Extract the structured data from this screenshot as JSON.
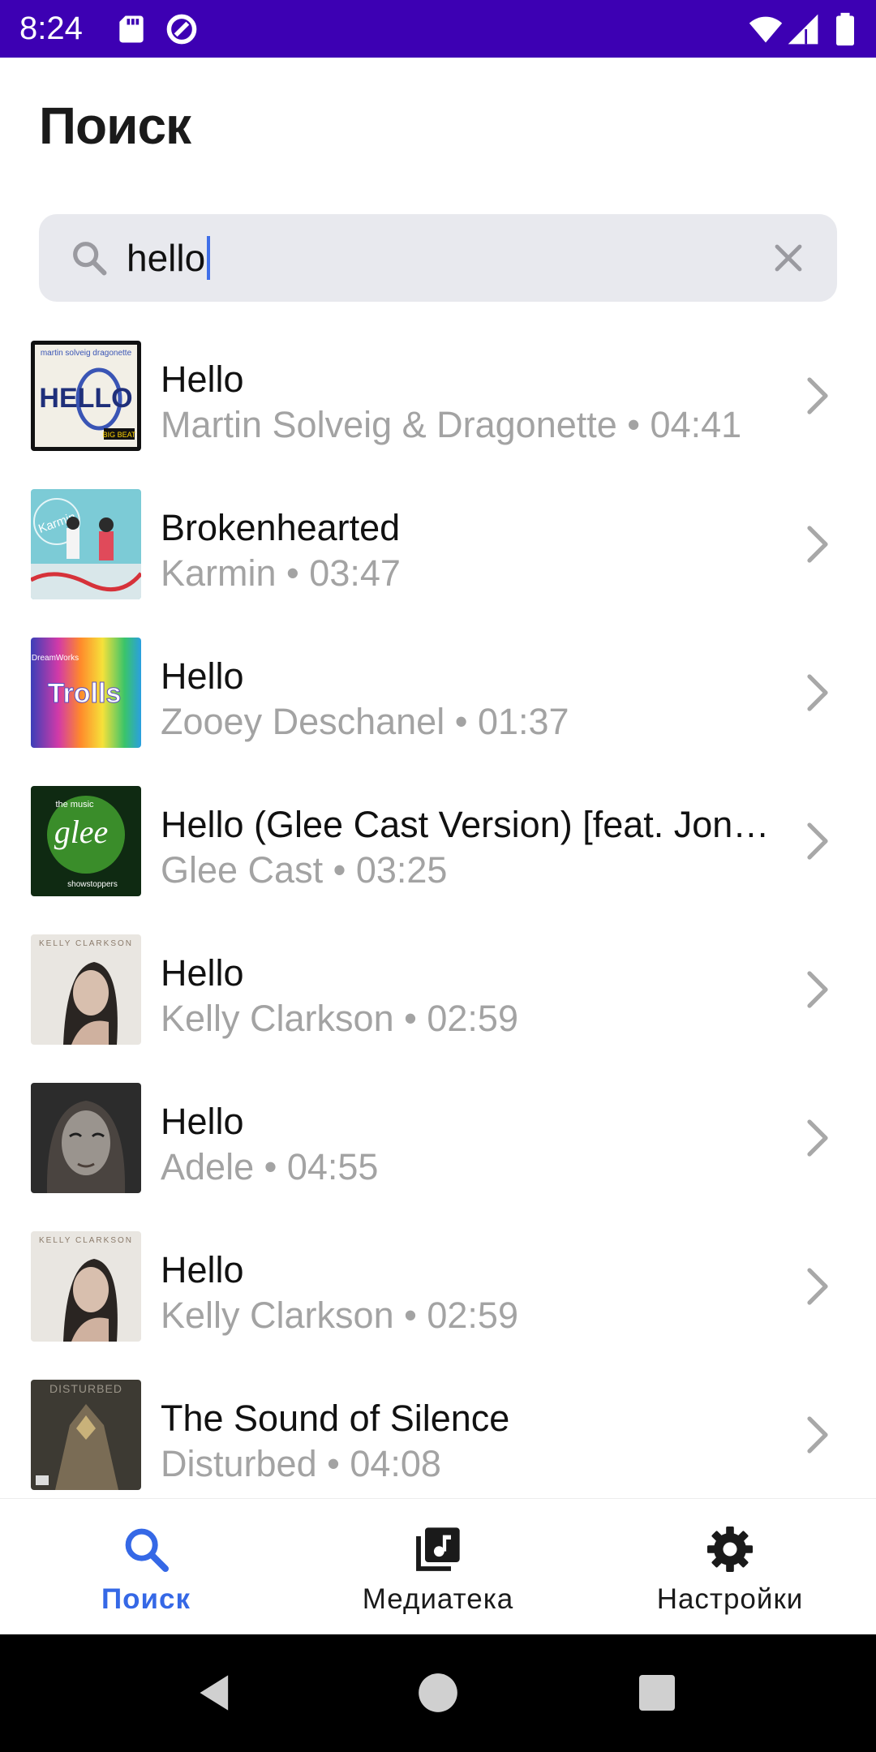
{
  "status_bar": {
    "time": "8:24"
  },
  "page": {
    "title": "Поиск"
  },
  "search": {
    "value": "hello"
  },
  "results": [
    {
      "title": "Hello",
      "meta": "Martin Solveig & Dragonette • 04:41"
    },
    {
      "title": "Brokenhearted",
      "meta": "Karmin • 03:47"
    },
    {
      "title": "Hello",
      "meta": "Zooey Deschanel • 01:37"
    },
    {
      "title": "Hello (Glee Cast Version) [feat. Jonat...",
      "meta": "Glee Cast • 03:25"
    },
    {
      "title": "Hello",
      "meta": "Kelly Clarkson • 02:59"
    },
    {
      "title": "Hello",
      "meta": "Adele • 04:55"
    },
    {
      "title": "Hello",
      "meta": "Kelly Clarkson • 02:59"
    },
    {
      "title": "The Sound of Silence",
      "meta": "Disturbed • 04:08"
    }
  ],
  "covers": {
    "r0": {
      "top": "martin solveig dragonette",
      "main": "HELLO",
      "badge": "BIG BEAT"
    },
    "r1": {
      "main": "Karmin"
    },
    "r2": {
      "top": "DreamWorks",
      "main": "Trolls"
    },
    "r3": {
      "top": "the music",
      "main": "glee",
      "bottom": "showstoppers"
    },
    "r4": {
      "top": "KELLY CLARKSON"
    },
    "r6": {
      "top": "KELLY CLARKSON"
    },
    "r7": {
      "top": "DISTURBED"
    }
  },
  "nav": {
    "search_label": "Поиск",
    "library_label": "Медиатека",
    "settings_label": "Настройки"
  },
  "colors": {
    "status_bar": "#3d00b3",
    "accent": "#3568e6",
    "search_bg": "#e8e9ee",
    "meta_text": "#a3a3a3"
  },
  "icons": {
    "status": [
      "sd-card-icon",
      "data-saver-icon",
      "wifi-icon",
      "signal-icon",
      "battery-icon"
    ],
    "nav": [
      "search-icon",
      "music-library-icon",
      "gear-icon"
    ],
    "system": [
      "back-icon",
      "home-icon",
      "recents-icon"
    ]
  }
}
